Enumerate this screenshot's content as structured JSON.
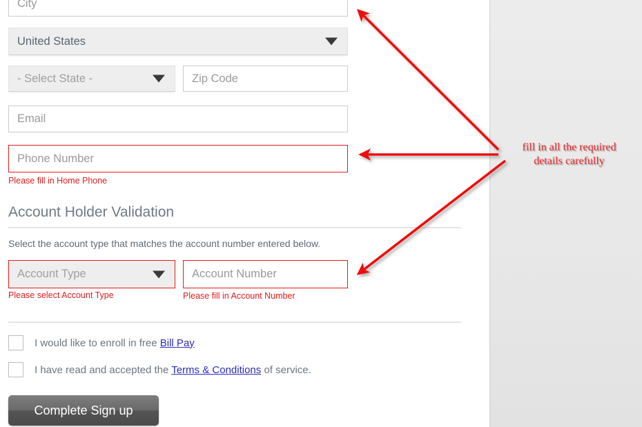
{
  "form": {
    "fields": {
      "city": {
        "placeholder": "City",
        "value": ""
      },
      "country": {
        "selected": "United States",
        "is_placeholder": false
      },
      "state": {
        "selected": "- Select State -",
        "is_placeholder": true
      },
      "zip": {
        "placeholder": "Zip Code",
        "value": ""
      },
      "email": {
        "placeholder": "Email",
        "value": ""
      },
      "phone": {
        "placeholder": "Phone Number",
        "value": "",
        "error": "Please fill in Home Phone"
      },
      "account_type": {
        "selected": "Account Type",
        "is_placeholder": true,
        "error": "Please select Account Type"
      },
      "account_number": {
        "placeholder": "Account Number",
        "value": "",
        "error": "Please fill in Account Number"
      }
    },
    "section": {
      "title": "Account Holder Validation",
      "help": "Select the account type that matches the account number entered below."
    },
    "checkboxes": [
      {
        "prefix": "I would like to enroll in free ",
        "link": "Bill Pay",
        "suffix": "",
        "checked": false
      },
      {
        "prefix": "I have read and accepted the ",
        "link": "Terms & Conditions",
        "suffix": " of service.",
        "checked": false
      }
    ],
    "submit_label": "Complete Sign up"
  },
  "annotation": {
    "text_line1": "fill in all the required",
    "text_line2": "details carefully",
    "color": "#e8262a",
    "arrow_count": 3
  },
  "colors": {
    "error_red": "#e21b1b",
    "annotation_red": "#e8262a",
    "link_blue": "#2b2bbb",
    "panel_gray": "#e9e9e9",
    "button_gray": "#6b6b6b"
  }
}
